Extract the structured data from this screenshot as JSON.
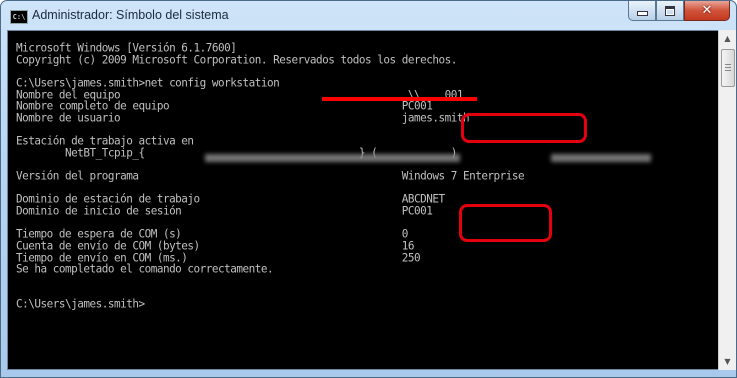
{
  "window": {
    "title": "Administrador: Símbolo del sistema",
    "icon_label": "C:\\",
    "controls": [
      "minimize-icon",
      "maximize-icon",
      "close-icon"
    ]
  },
  "console": {
    "lines": [
      "Microsoft Windows [Versión 6.1.7600]",
      "Copyright (c) 2009 Microsoft Corporation. Reservados todos los derechos.",
      "",
      "C:\\Users\\james.smith>net config workstation",
      "Nombre del equipo                                               \\\\    001",
      "Nombre completo de equipo                                      PC001",
      "Nombre de usuario                                              james.smith",
      "",
      "Estación de trabajo activa en",
      "        NetBT_Tcpip_{                                   } (            )",
      "",
      "Versión del programa                                           Windows 7 Enterprise",
      "",
      "Dominio de estación de trabajo                                 ABCDNET",
      "Dominio de inicio de sesión                                    PC001",
      "",
      "Tiempo de espera de COM (s)                                    0",
      "Cuenta de envío de COM (bytes)                                 16",
      "Tiempo de envío en COM (ms.)                                   250",
      "Se ha completado el comando correctamente.",
      "",
      "",
      "C:\\Users\\james.smith>"
    ]
  },
  "colors": {
    "console_bg": "#000000",
    "console_text": "#c0c0c0",
    "highlight": "#e4000f",
    "title_text": "#1b2b3b"
  }
}
